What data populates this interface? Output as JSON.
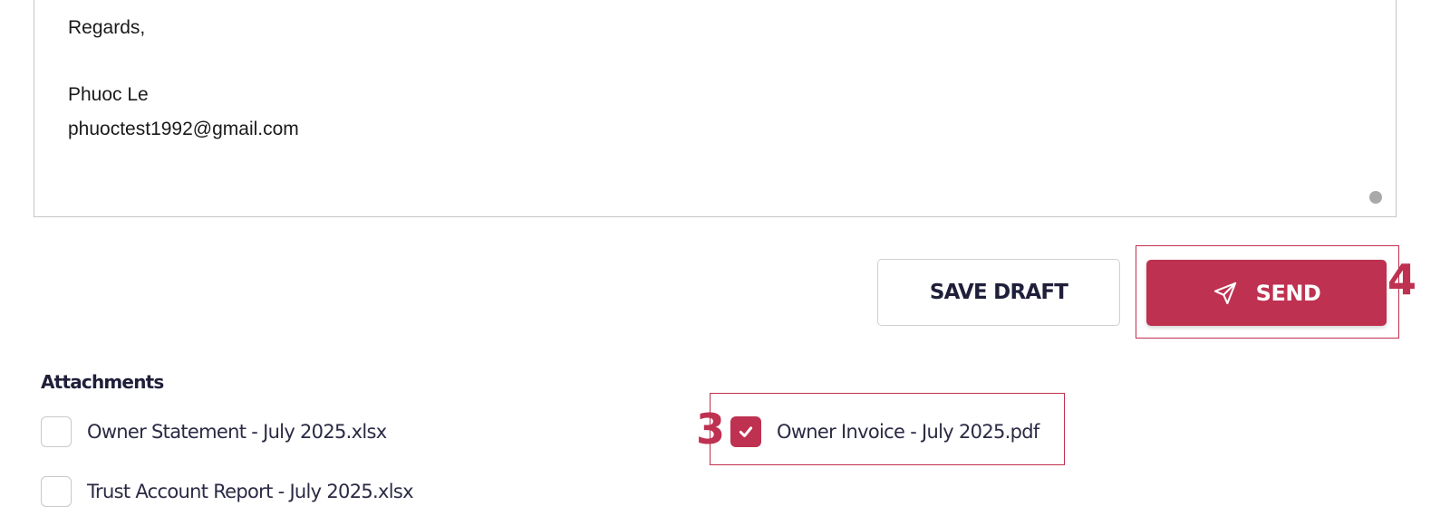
{
  "message": {
    "lines": [
      "Regards,",
      "Phuoc Le",
      "phuoctest1992@gmail.com"
    ]
  },
  "actions": {
    "save_draft_label": "SAVE DRAFT",
    "send_label": "SEND"
  },
  "attachments": {
    "heading": "Attachments",
    "items": [
      {
        "label": "Owner Statement - July 2025.xlsx",
        "checked": false
      },
      {
        "label": "Trust Account Report - July 2025.xlsx",
        "checked": false
      },
      {
        "label": "Owner Invoice - July 2025.pdf",
        "checked": true
      }
    ]
  },
  "annotations": {
    "step_3": "3",
    "step_4": "4"
  },
  "colors": {
    "accent": "#be3150",
    "text_dark": "#1f1f3a",
    "border": "#c6c6c6"
  },
  "icons": {
    "send": "paper-plane-icon",
    "checkmark": "checkmark-icon",
    "resize": "resize-handle-icon"
  }
}
